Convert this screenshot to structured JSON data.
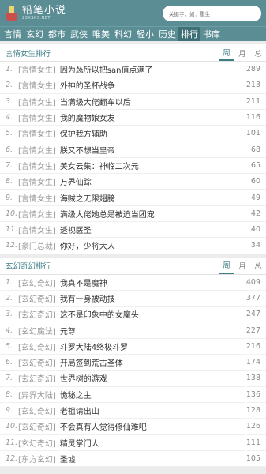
{
  "header": {
    "logo_text": "铅笔小说",
    "logo_sub": "23XSKS.NET",
    "search_placeholder": "关键字，如：重生"
  },
  "nav": [
    "言情",
    "玄幻",
    "都市",
    "武侠",
    "唯美",
    "科幻",
    "轻小",
    "历史",
    "排行",
    "书库"
  ],
  "nav_active": 8,
  "rank1": {
    "title": "言情女生排行",
    "tabs": [
      "周",
      "月",
      "总"
    ],
    "items": [
      {
        "idx": "1.",
        "cat": "[言情女生]",
        "title": "因为怂所以把san值点满了",
        "count": "289"
      },
      {
        "idx": "2.",
        "cat": "[言情女生]",
        "title": "外神的圣杯战争",
        "count": "213"
      },
      {
        "idx": "3.",
        "cat": "[言情女生]",
        "title": "当满级大佬翻车以后",
        "count": "211"
      },
      {
        "idx": "4.",
        "cat": "[言情女生]",
        "title": "我的魔物娘女友",
        "count": "116"
      },
      {
        "idx": "5.",
        "cat": "[言情女生]",
        "title": "保护我方辅助",
        "count": "101"
      },
      {
        "idx": "6.",
        "cat": "[言情女生]",
        "title": "朕又不想当皇帝",
        "count": "68"
      },
      {
        "idx": "7.",
        "cat": "[言情女生]",
        "title": "美女云集：神临二次元",
        "count": "65"
      },
      {
        "idx": "8.",
        "cat": "[言情女生]",
        "title": "万界仙踪",
        "count": "60"
      },
      {
        "idx": "9.",
        "cat": "[言情女生]",
        "title": "海贼之无限翅膀",
        "count": "49"
      },
      {
        "idx": "10.",
        "cat": "[言情女生]",
        "title": "满级大佬她总是被迫当团宠",
        "count": "42"
      },
      {
        "idx": "11.",
        "cat": "[言情女生]",
        "title": "透视医圣",
        "count": "40"
      },
      {
        "idx": "12.",
        "cat": "[豪门总裁]",
        "title": "你好，少将大人",
        "count": "34"
      }
    ]
  },
  "rank2": {
    "title": "玄幻奇幻排行",
    "tabs": [
      "周",
      "月",
      "总"
    ],
    "items": [
      {
        "idx": "1.",
        "cat": "[玄幻奇幻]",
        "title": "我真不是魔神",
        "count": "409"
      },
      {
        "idx": "2.",
        "cat": "[玄幻奇幻]",
        "title": "我有一身被动技",
        "count": "377"
      },
      {
        "idx": "3.",
        "cat": "[玄幻奇幻]",
        "title": "这不是印象中的女魔头",
        "count": "247"
      },
      {
        "idx": "4.",
        "cat": "[玄幻魔法]",
        "title": "元尊",
        "count": "227"
      },
      {
        "idx": "5.",
        "cat": "[玄幻奇幻]",
        "title": "斗罗大陆4终极斗罗",
        "count": "216"
      },
      {
        "idx": "6.",
        "cat": "[玄幻奇幻]",
        "title": "开局签到荒古圣体",
        "count": "174"
      },
      {
        "idx": "7.",
        "cat": "[玄幻奇幻]",
        "title": "世界树的游戏",
        "count": "138"
      },
      {
        "idx": "8.",
        "cat": "[异界大陆]",
        "title": "诡秘之主",
        "count": "136"
      },
      {
        "idx": "9.",
        "cat": "[玄幻奇幻]",
        "title": "老祖请出山",
        "count": "128"
      },
      {
        "idx": "10.",
        "cat": "[玄幻奇幻]",
        "title": "不会真有人觉得修仙难吧",
        "count": "126"
      },
      {
        "idx": "11.",
        "cat": "[玄幻奇幻]",
        "title": "精灵掌门人",
        "count": "111"
      },
      {
        "idx": "12.",
        "cat": "[东方玄幻]",
        "title": "圣墟",
        "count": "105"
      }
    ]
  }
}
